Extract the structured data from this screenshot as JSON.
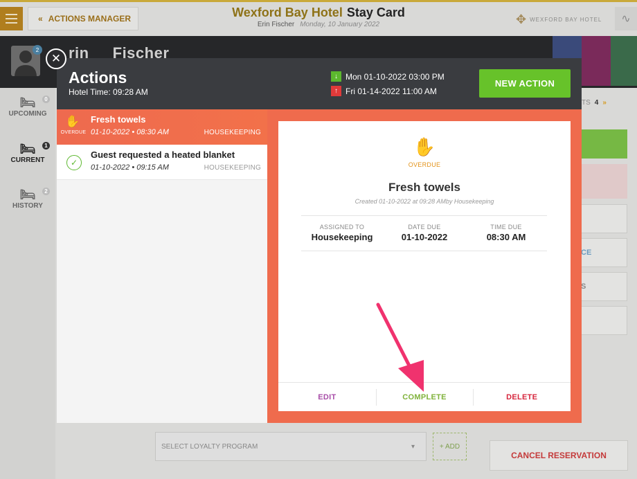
{
  "header": {
    "actions_manager_label": "ACTIONS MANAGER",
    "hotel_name": "Wexford Bay Hotel",
    "page_title": "Stay Card",
    "guest_full_name": "Erin Fischer",
    "date": "Monday, 10 January 2022",
    "logo_text": "WEXFORD BAY HOTEL"
  },
  "guest": {
    "first_partial": "rin",
    "last_name": "Fischer",
    "avatar_badge": "2"
  },
  "sidebar": {
    "items": [
      {
        "label": "UPCOMING",
        "count": "0"
      },
      {
        "label": "CURRENT",
        "count": "1"
      },
      {
        "label": "HISTORY",
        "count": "2"
      }
    ]
  },
  "background": {
    "nights_label": "TS",
    "nights_count": "4",
    "right_buttons": [
      "CE",
      "S"
    ],
    "loyalty_placeholder": "SELECT LOYALTY PROGRAM",
    "add_label": "+ ADD",
    "cancel_label": "CANCEL RESERVATION"
  },
  "modal": {
    "title": "Actions",
    "hotel_time": "Hotel Time: 09:28 AM",
    "arrival": "Mon 01-10-2022 03:00 PM",
    "departure": "Fri 01-14-2022 11:00 AM",
    "new_action_label": "NEW ACTION",
    "list": [
      {
        "title": "Fresh towels",
        "datetime": "01-10-2022 • 08:30 AM",
        "category": "HOUSEKEEPING",
        "status": "OVERDUE"
      },
      {
        "title": "Guest requested a heated blanket",
        "datetime": "01-10-2022 • 09:15 AM",
        "category": "HOUSEKEEPING",
        "status": "completed"
      }
    ],
    "detail": {
      "status": "OVERDUE",
      "title": "Fresh towels",
      "created": "Created 01-10-2022 at 09:28 AMby Housekeeping",
      "assigned_label": "ASSIGNED TO",
      "assigned_value": "Housekeeping",
      "date_label": "DATE DUE",
      "date_value": "01-10-2022",
      "time_label": "TIME DUE",
      "time_value": "08:30 AM",
      "edit_label": "EDIT",
      "complete_label": "COMPLETE",
      "delete_label": "DELETE"
    }
  },
  "colors": {
    "accent_orange": "#ef6b4d",
    "green": "#67c22a",
    "edit": "#a84ea8",
    "complete": "#7fb23a",
    "delete": "#d7263d",
    "arrow": "#f0326e"
  }
}
